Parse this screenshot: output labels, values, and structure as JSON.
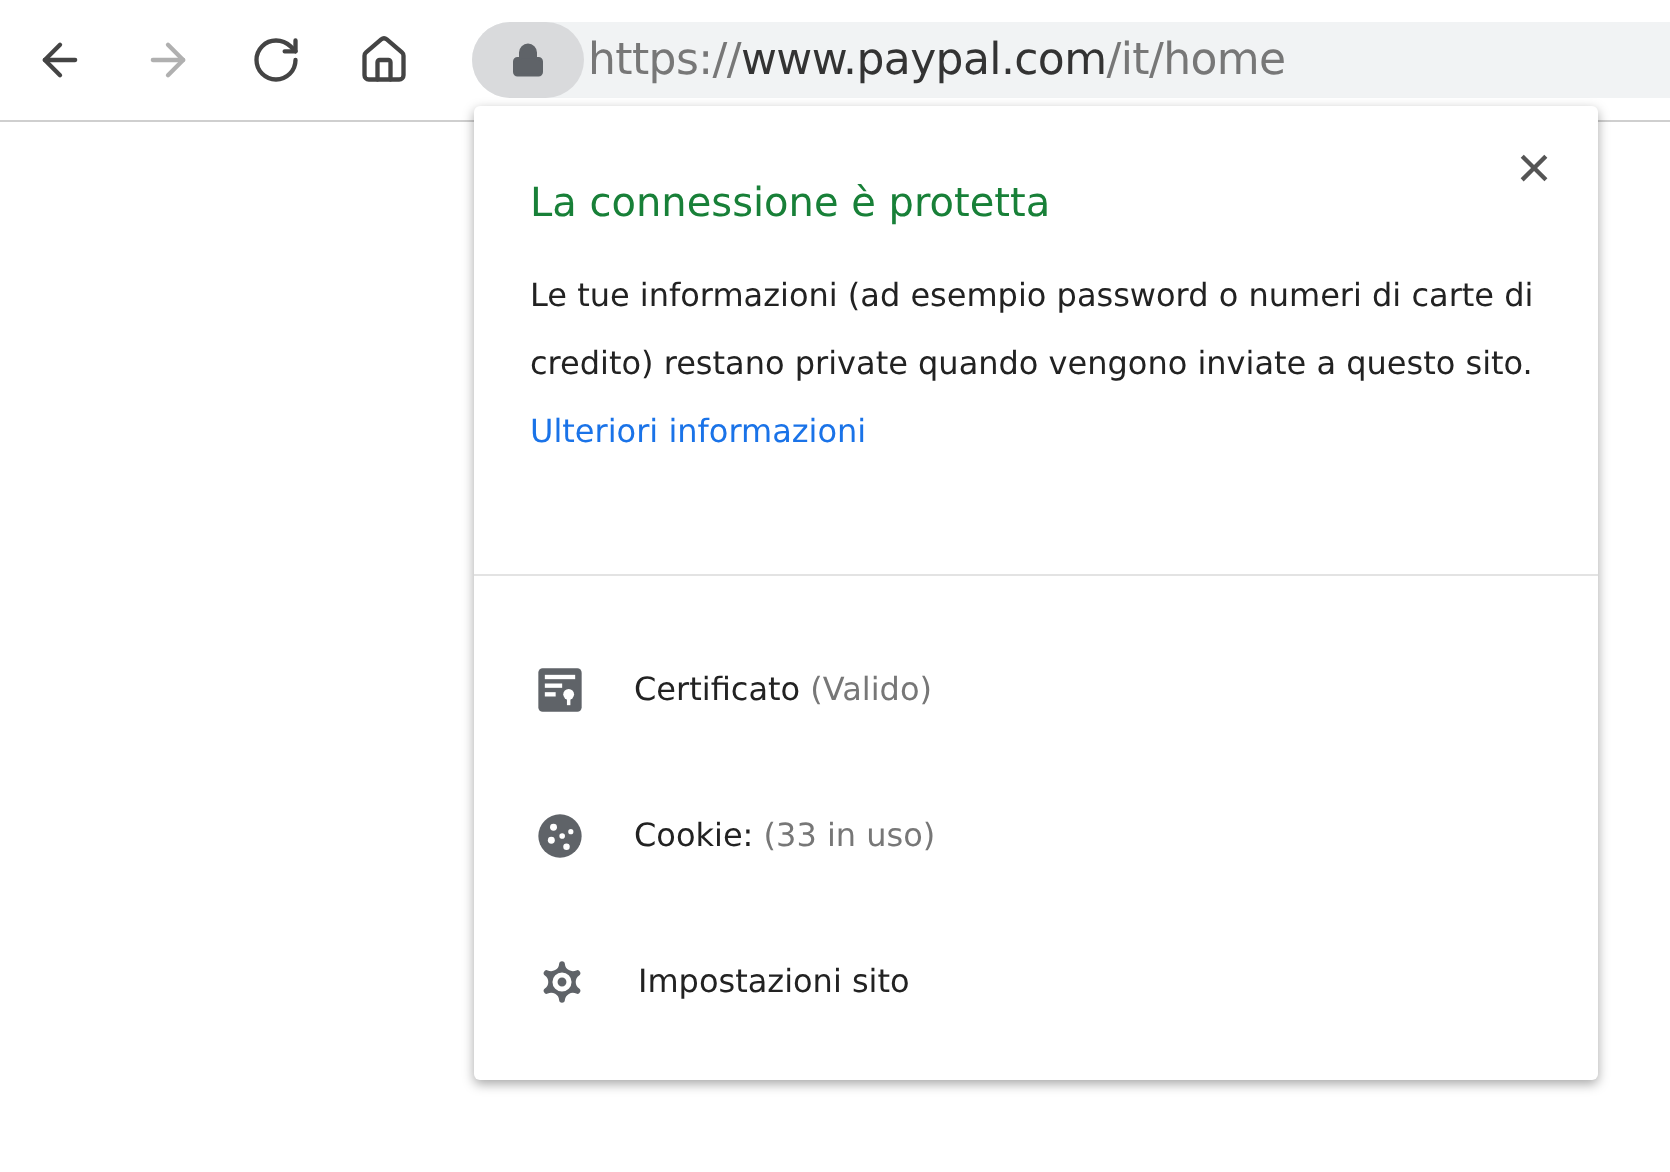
{
  "toolbar": {
    "buttons": [
      {
        "kind": "back",
        "disabled": false
      },
      {
        "kind": "forward",
        "disabled": true
      },
      {
        "kind": "reload",
        "disabled": false
      },
      {
        "kind": "home",
        "disabled": false
      }
    ]
  },
  "address_bar": {
    "scheme": "https://",
    "host": "www.paypal.com",
    "path": "/it/home"
  },
  "popup": {
    "title": "La connessione è protetta",
    "message": "Le tue informazioni (ad esempio password o numeri di carte di credito) restano private quando vengono inviate a questo sito.",
    "link": "Ulteriori informazioni",
    "close": "×",
    "items": [
      {
        "kind": "certificate",
        "label": "Certificato",
        "detail": "(Valido)"
      },
      {
        "kind": "cookie",
        "label": "Cookie:",
        "detail": "(33 in uso)"
      },
      {
        "kind": "settings",
        "label": "Impostazioni sito"
      }
    ]
  }
}
